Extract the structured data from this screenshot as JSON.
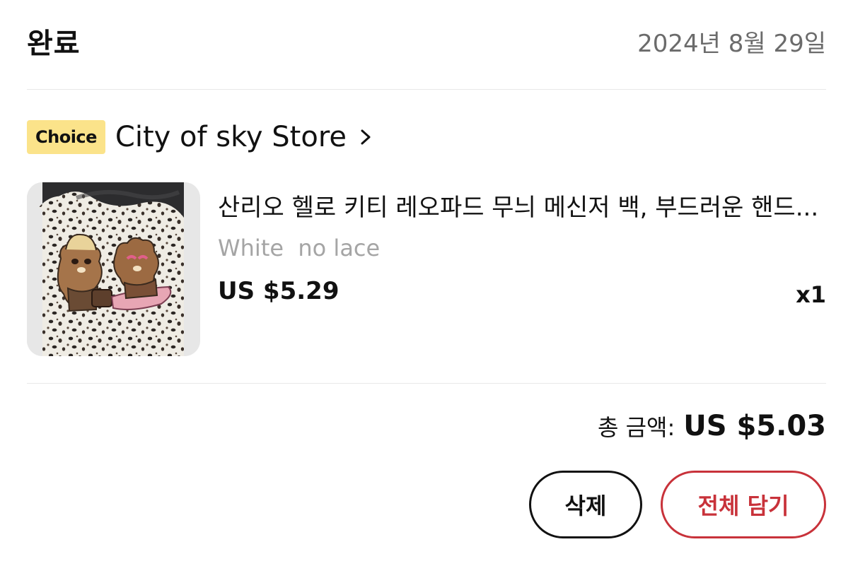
{
  "order": {
    "status": "완료",
    "date": "2024년 8월 29일"
  },
  "store": {
    "badge": "Choice",
    "name": "City of sky Store",
    "chevron_icon": "chevron-right-icon"
  },
  "product": {
    "title": "산리오 헬로 키티 레오파드 무늬 메신저 백, 부드러운 핸드...",
    "variant": "White  no lace",
    "price": "US $5.29",
    "quantity": "x1",
    "image_description": "leopard-print tote bag with two bear-like character patches"
  },
  "summary": {
    "total_label": "총 금액:",
    "total_value": "US $5.03"
  },
  "actions": {
    "delete_label": "삭제",
    "add_all_label": "전체 담기"
  },
  "colors": {
    "badge_bg": "#fbe38a",
    "accent_red": "#c8323a",
    "muted_text": "#a5a5a5",
    "date_text": "#6b6b6b",
    "divider": "#e8e8e8"
  }
}
